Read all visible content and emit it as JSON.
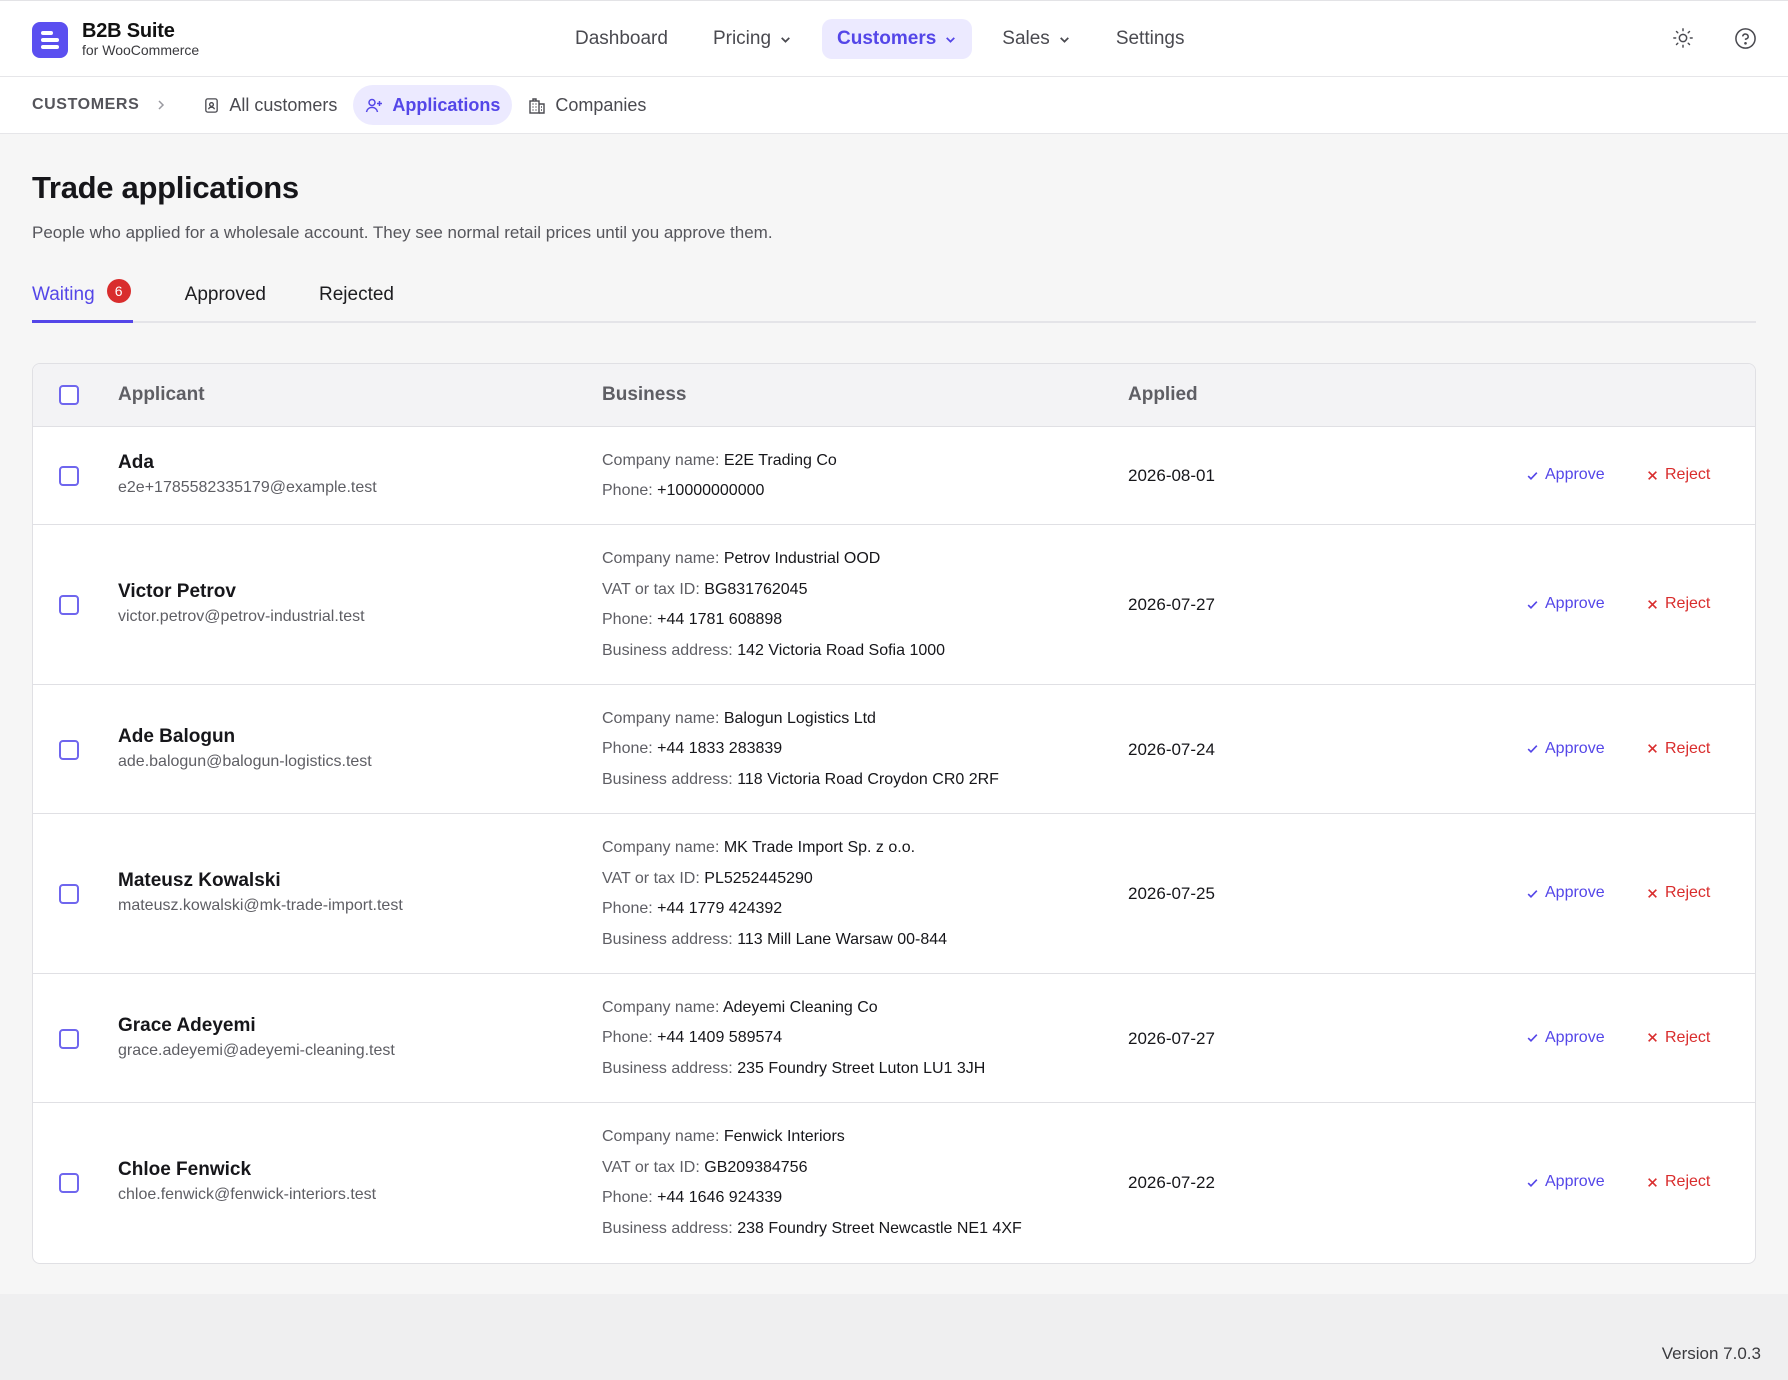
{
  "brand": {
    "title": "B2B Suite",
    "subtitle": "for WooCommerce"
  },
  "nav": [
    {
      "label": "Dashboard",
      "dropdown": false,
      "active": false
    },
    {
      "label": "Pricing",
      "dropdown": true,
      "active": false
    },
    {
      "label": "Customers",
      "dropdown": true,
      "active": true
    },
    {
      "label": "Sales",
      "dropdown": true,
      "active": false
    },
    {
      "label": "Settings",
      "dropdown": false,
      "active": false
    }
  ],
  "top_icons": [
    "sun-icon",
    "help-circle-icon"
  ],
  "breadcrumb": {
    "root": "CUSTOMERS",
    "tabs": [
      {
        "label": "All customers",
        "icon": "contact-card-icon",
        "active": false
      },
      {
        "label": "Applications",
        "icon": "user-plus-icon",
        "active": true
      },
      {
        "label": "Companies",
        "icon": "building-icon",
        "active": false
      }
    ]
  },
  "page": {
    "title": "Trade applications",
    "description": "People who applied for a wholesale account. They see normal retail prices until you approve them."
  },
  "tabs": [
    {
      "label": "Waiting",
      "badge": "6",
      "active": true
    },
    {
      "label": "Approved",
      "active": false
    },
    {
      "label": "Rejected",
      "active": false
    }
  ],
  "table": {
    "headers": {
      "applicant": "Applicant",
      "business": "Business",
      "applied": "Applied"
    },
    "approve_label": "Approve",
    "reject_label": "Reject",
    "rows": [
      {
        "name": "Ada",
        "email": "e2e+1785582335179@example.test",
        "applied": "2026-08-01",
        "business": [
          {
            "k": "Company name:",
            "v": "E2E Trading Co"
          },
          {
            "k": "Phone:",
            "v": "+10000000000"
          }
        ]
      },
      {
        "name": "Victor Petrov",
        "email": "victor.petrov@petrov-industrial.test",
        "applied": "2026-07-27",
        "business": [
          {
            "k": "Company name:",
            "v": "Petrov Industrial OOD"
          },
          {
            "k": "VAT or tax ID:",
            "v": "BG831762045"
          },
          {
            "k": "Phone:",
            "v": "+44 1781 608898"
          },
          {
            "k": "Business address:",
            "v": "142 Victoria Road Sofia 1000"
          }
        ]
      },
      {
        "name": "Ade Balogun",
        "email": "ade.balogun@balogun-logistics.test",
        "applied": "2026-07-24",
        "business": [
          {
            "k": "Company name:",
            "v": "Balogun Logistics Ltd"
          },
          {
            "k": "Phone:",
            "v": "+44 1833 283839"
          },
          {
            "k": "Business address:",
            "v": "118 Victoria Road Croydon CR0 2RF"
          }
        ]
      },
      {
        "name": "Mateusz Kowalski",
        "email": "mateusz.kowalski@mk-trade-import.test",
        "applied": "2026-07-25",
        "business": [
          {
            "k": "Company name:",
            "v": "MK Trade Import Sp. z o.o."
          },
          {
            "k": "VAT or tax ID:",
            "v": "PL5252445290"
          },
          {
            "k": "Phone:",
            "v": "+44 1779 424392"
          },
          {
            "k": "Business address:",
            "v": "113 Mill Lane Warsaw 00-844"
          }
        ]
      },
      {
        "name": "Grace Adeyemi",
        "email": "grace.adeyemi@adeyemi-cleaning.test",
        "applied": "2026-07-27",
        "business": [
          {
            "k": "Company name:",
            "v": "Adeyemi Cleaning Co"
          },
          {
            "k": "Phone:",
            "v": "+44 1409 589574"
          },
          {
            "k": "Business address:",
            "v": "235 Foundry Street Luton LU1 3JH"
          }
        ]
      },
      {
        "name": "Chloe Fenwick",
        "email": "chloe.fenwick@fenwick-interiors.test",
        "applied": "2026-07-22",
        "business": [
          {
            "k": "Company name:",
            "v": "Fenwick Interiors"
          },
          {
            "k": "VAT or tax ID:",
            "v": "GB209384756"
          },
          {
            "k": "Phone:",
            "v": "+44 1646 924339"
          },
          {
            "k": "Business address:",
            "v": "238 Foundry Street Newcastle NE1 4XF"
          }
        ]
      }
    ]
  },
  "footer": {
    "version": "Version 7.0.3"
  }
}
